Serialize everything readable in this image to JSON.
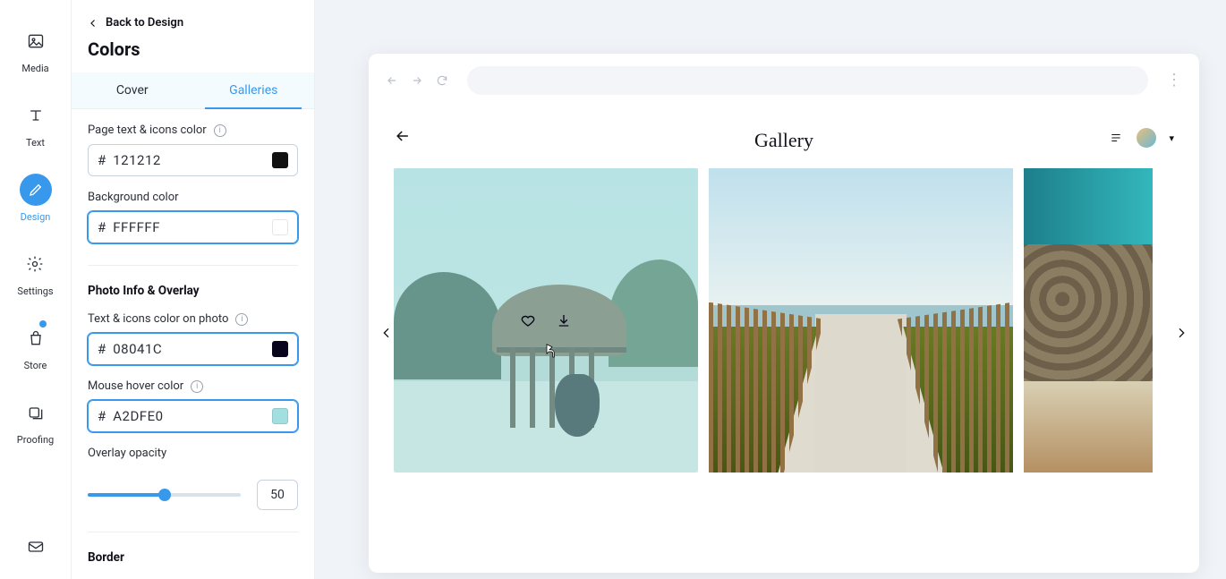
{
  "rail": {
    "media": "Media",
    "text": "Text",
    "design": "Design",
    "settings": "Settings",
    "store": "Store",
    "proofing": "Proofing"
  },
  "panel": {
    "back": "Back to Design",
    "title": "Colors",
    "tabs": {
      "cover": "Cover",
      "galleries": "Galleries"
    },
    "fields": {
      "page_text_icons": {
        "label": "Page text & icons color",
        "value": "121212",
        "swatch": "#121212"
      },
      "background": {
        "label": "Background color",
        "value": "FFFFFF",
        "swatch": "#FFFFFF"
      },
      "section_photo_header": "Photo Info & Overlay",
      "photo_text_icons": {
        "label": "Text & icons color on photo",
        "value": "08041C",
        "swatch": "#08041C"
      },
      "hover_color": {
        "label": "Mouse hover color",
        "value": "A2DFE0",
        "swatch": "#A2DFE0"
      },
      "overlay_opacity": {
        "label": "Overlay opacity",
        "value": "50",
        "percent": 50
      },
      "section_border_header": "Border"
    }
  },
  "preview": {
    "title": "Gallery"
  }
}
